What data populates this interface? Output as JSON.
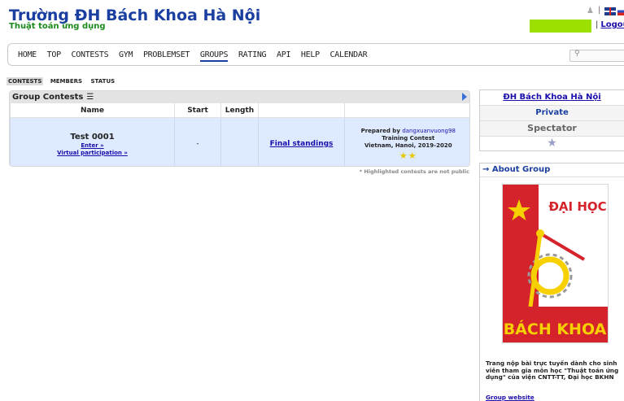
{
  "header": {
    "title": "Trường ĐH Bách Khoa Hà Nội",
    "subtitle": "Thuật toán ứng dụng",
    "logout_label": "Logout",
    "separator": "|",
    "user_icon": "user-icon",
    "flags": [
      "uk-flag-icon",
      "ru-flag-icon"
    ]
  },
  "nav": {
    "items": [
      "HOME",
      "TOP",
      "CONTESTS",
      "GYM",
      "PROBLEMSET",
      "GROUPS",
      "RATING",
      "API",
      "HELP",
      "CALENDAR"
    ],
    "active": "GROUPS",
    "search_icon": "search-icon"
  },
  "subtabs": {
    "items": [
      "CONTESTS",
      "MEMBERS",
      "STATUS"
    ],
    "active": "CONTESTS"
  },
  "contests": {
    "title": "Group Contests",
    "columns": [
      "Name",
      "Start",
      "Length",
      "",
      ""
    ],
    "row": {
      "name": "Test 0001",
      "enter": "Enter »",
      "virtual": "Virtual participation »",
      "start": "-",
      "length": "",
      "standings": "Final standings",
      "prepared_prefix": "Prepared by",
      "author": "dangxuanvuong98",
      "type": "Training Contest",
      "location": "Vietnam, Hanoi, 2019-2020",
      "stars": "★★"
    },
    "note": "* Highlighted contests are not public"
  },
  "side": {
    "group_name": "ĐH Bách Khoa Hà Nội",
    "privacy": "Private",
    "role": "Spectator",
    "star": "★"
  },
  "about": {
    "title": "→ About Group",
    "logo_top": "ĐẠI HỌC",
    "logo_bottom": "BÁCH KHOA",
    "description": "Trang nộp bài trực tuyến dành cho sinh viên tham gia môn học \"Thuật toán ứng dụng\" của viện CNTT-TT, Đại học BKHN",
    "website": "Group website"
  },
  "colors": {
    "title_blue": "#1a3fa0",
    "subtitle_green": "#1c8a1c",
    "user_box": "#9be000",
    "row_highlight": "#ddeaff",
    "logo_red": "#d4232a",
    "logo_yellow": "#f6d000"
  }
}
